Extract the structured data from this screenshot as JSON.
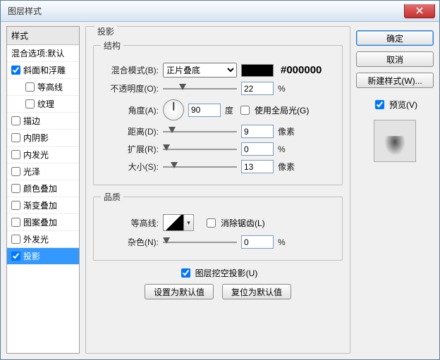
{
  "window": {
    "title": "图层样式"
  },
  "buttons": {
    "ok": "确定",
    "cancel": "取消",
    "new_style": "新建样式(W)...",
    "defaults_set": "设置为默认值",
    "defaults_reset": "复位为默认值"
  },
  "preview": {
    "label": "预览(V)",
    "checked": true
  },
  "sidebar": {
    "header": "样式",
    "blend_row": "混合选项:默认",
    "items": [
      {
        "label": "斜面和浮雕",
        "checked": true
      },
      {
        "label": "等高线",
        "checked": false,
        "indent": true
      },
      {
        "label": "纹理",
        "checked": false,
        "indent": true
      },
      {
        "label": "描边",
        "checked": false
      },
      {
        "label": "内阴影",
        "checked": false
      },
      {
        "label": "内发光",
        "checked": false
      },
      {
        "label": "光泽",
        "checked": false
      },
      {
        "label": "颜色叠加",
        "checked": false
      },
      {
        "label": "渐变叠加",
        "checked": false
      },
      {
        "label": "图案叠加",
        "checked": false
      },
      {
        "label": "外发光",
        "checked": false
      },
      {
        "label": "投影",
        "checked": true,
        "selected": true
      }
    ]
  },
  "panel": {
    "title": "投影",
    "group_structure": "结构",
    "group_quality": "品质",
    "blend_mode": {
      "label": "混合模式(B):",
      "value": "正片叠底",
      "hex": "#000000"
    },
    "opacity": {
      "label": "不透明度(O):",
      "value": "22",
      "unit": "%",
      "pos": 22
    },
    "angle": {
      "label": "角度(A):",
      "value": "90",
      "unit": "度",
      "global_label": "使用全局光(G)",
      "global_checked": false
    },
    "distance": {
      "label": "距离(D):",
      "value": "9",
      "unit": "像素",
      "pos": 8
    },
    "spread": {
      "label": "扩展(R):",
      "value": "0",
      "unit": "%",
      "pos": 0
    },
    "size": {
      "label": "大小(S):",
      "value": "13",
      "unit": "像素",
      "pos": 10
    },
    "contour": {
      "label": "等高线:",
      "antialias_label": "消除锯齿(L)",
      "antialias_checked": false
    },
    "noise": {
      "label": "杂色(N):",
      "value": "0",
      "unit": "%",
      "pos": 0
    },
    "knockout": {
      "label": "图层挖空投影(U)",
      "checked": true
    }
  }
}
